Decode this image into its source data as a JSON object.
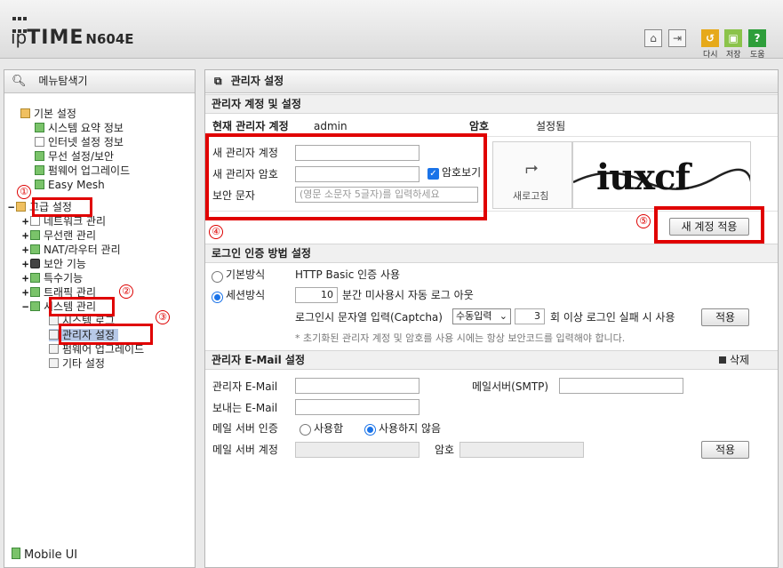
{
  "header": {
    "brand_ip": "ip",
    "brand_time": "TIME",
    "model": "N604E",
    "buttons": {
      "redo_label": "다시",
      "save_label": "저장",
      "help_label": "도움"
    }
  },
  "sidebar": {
    "title": "메뉴탐색기",
    "items": [
      {
        "label": "기본 설정"
      },
      {
        "label": "시스템 요약 정보"
      },
      {
        "label": "인터넷 설정 정보"
      },
      {
        "label": "무선 설정/보안"
      },
      {
        "label": "펌웨어 업그레이드"
      },
      {
        "label": "Easy Mesh"
      },
      {
        "label": "고급 설정"
      },
      {
        "label": "네트워크 관리"
      },
      {
        "label": "무선랜 관리"
      },
      {
        "label": "NAT/라우터 관리"
      },
      {
        "label": "보안 기능"
      },
      {
        "label": "특수기능"
      },
      {
        "label": "트래픽 관리"
      },
      {
        "label": "시스템 관리"
      },
      {
        "label": "시스템 로그"
      },
      {
        "label": "관리자 설정"
      },
      {
        "label": "펌웨어 업그레이드"
      },
      {
        "label": "기타 설정"
      }
    ],
    "footer": "Mobile UI"
  },
  "annotations": [
    "①",
    "②",
    "③",
    "④",
    "⑤"
  ],
  "main": {
    "title": "관리자 설정",
    "section_account": {
      "title": "관리자 계정 및 설정",
      "current_label": "현재 관리자 계정",
      "current_value": "admin",
      "password_label": "암호",
      "password_value": "설정됨",
      "new_account_label": "새 관리자 계정",
      "new_password_label": "새 관리자 암호",
      "show_password_label": "암호보기",
      "security_label": "보안 문자",
      "security_placeholder": "(영문 소문자 5글자)를 입력하세요",
      "refresh_label": "새로고침",
      "captcha_text": "iuxcf",
      "apply_button": "새 계정 적용"
    },
    "section_login": {
      "title": "로그인 인증 방법 설정",
      "basic_label": "기본방식",
      "basic_desc": "HTTP Basic 인증 사용",
      "session_label": "세션방식",
      "session_minutes": "10",
      "session_desc": "분간 미사용시 자동 로그 아웃",
      "captcha_label": "로그인시 문자열 입력(Captcha)",
      "captcha_mode": "수동입력",
      "fail_count": "3",
      "fail_desc": "회 이상 로그인 실패 시 사용",
      "apply_button": "적용",
      "note": "* 초기화된 관리자 계정 및 암호를 사용 시에는 항상 보안코드를 입력해야 합니다."
    },
    "section_email": {
      "title": "관리자 E-Mail 설정",
      "delete_label": "삭제",
      "admin_email_label": "관리자 E-Mail",
      "smtp_label": "메일서버(SMTP)",
      "sender_label": "보내는 E-Mail",
      "auth_label": "메일 서버 인증",
      "auth_on": "사용함",
      "auth_off": "사용하지 않음",
      "account_label": "메일 서버 계정",
      "password_label": "암호",
      "apply_button": "적용"
    }
  }
}
